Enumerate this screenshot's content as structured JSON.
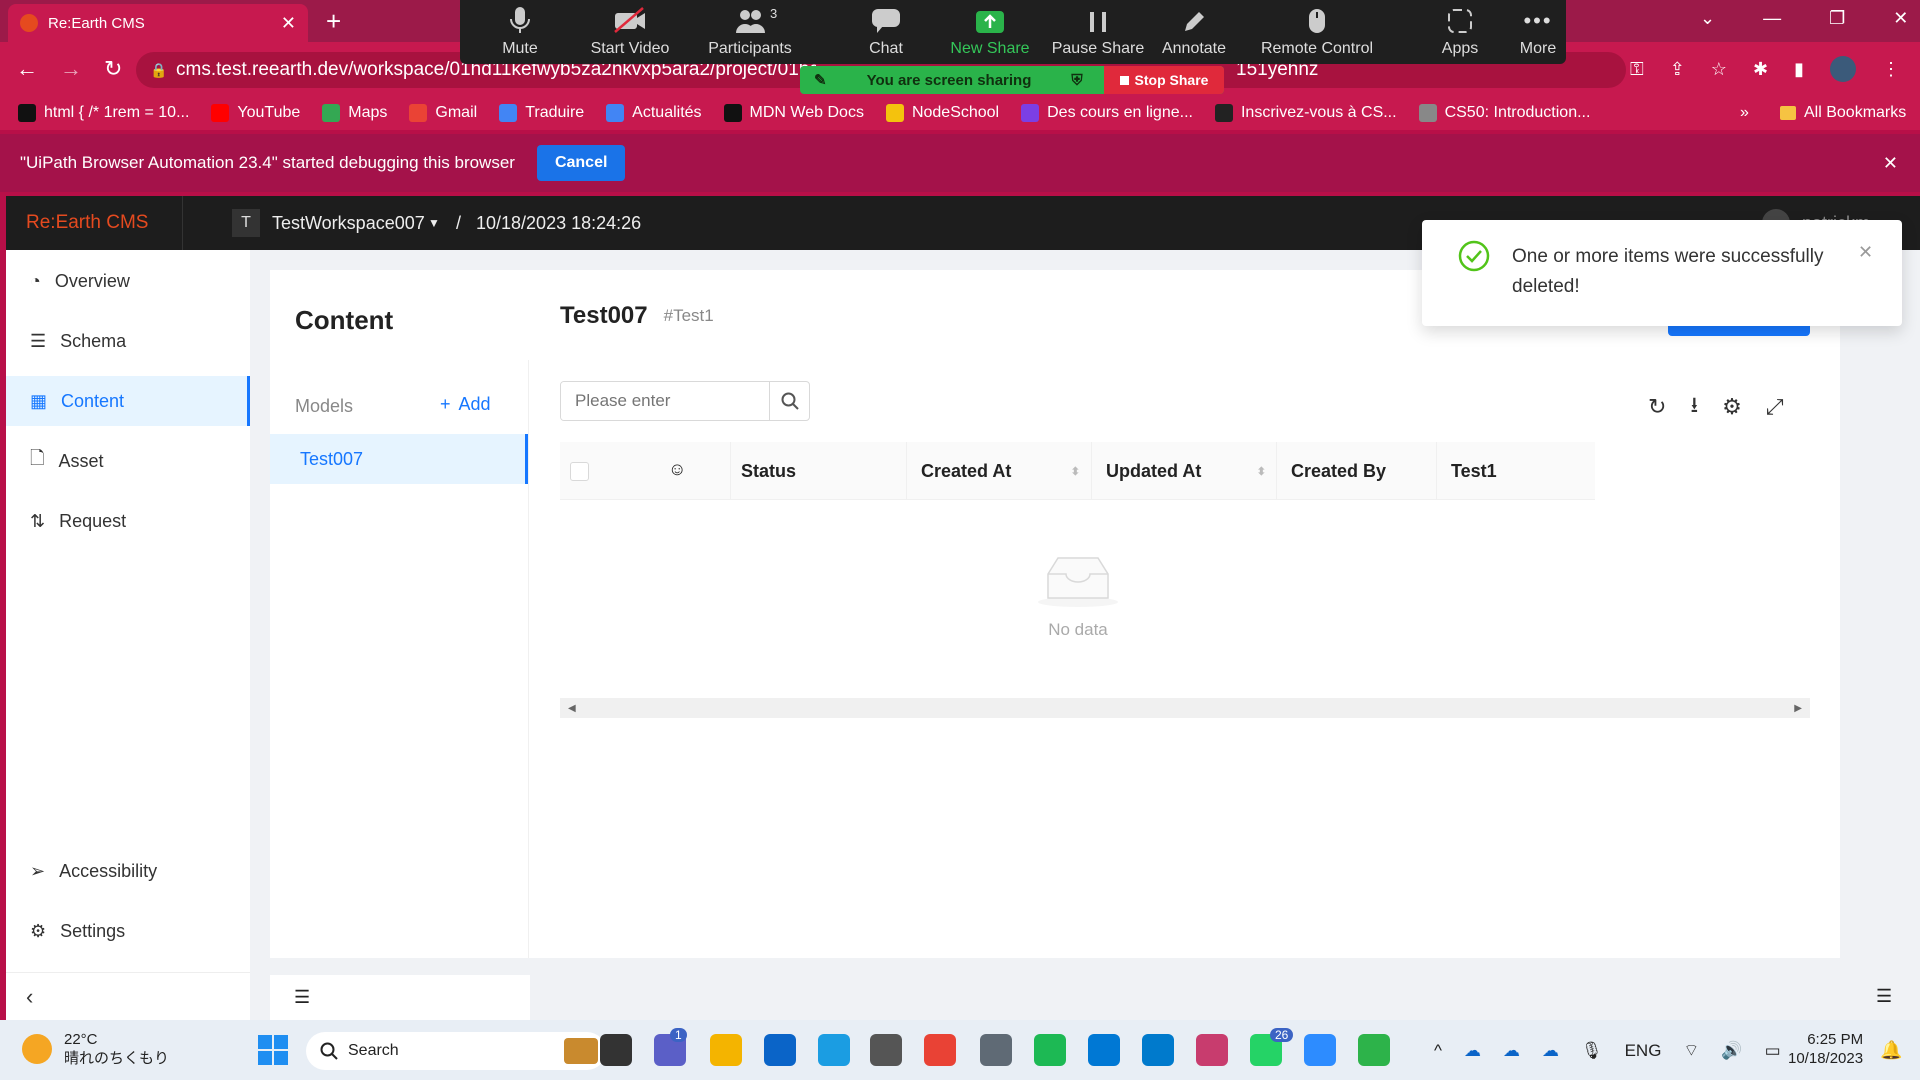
{
  "browser": {
    "tab_title": "Re:Earth CMS",
    "url": "cms.test.reearth.dev/workspace/01hd11kefwyb5za2nkvxp5ara2/project/01hd11k",
    "url_tail": "151yehnz",
    "bookmarks": [
      "html { /* 1rem = 10...",
      "YouTube",
      "Maps",
      "Gmail",
      "Traduire",
      "Actualités",
      "MDN Web Docs",
      "NodeSchool",
      "Des cours en ligne...",
      "Inscrivez-vous à CS...",
      "CS50: Introduction..."
    ],
    "bookmark_colors": [
      "#111111",
      "#ff0000",
      "#34a853",
      "#ea4335",
      "#4285f4",
      "#4285f4",
      "#111111",
      "#f4c20d",
      "#7b3fe4",
      "#222222",
      "#888888"
    ],
    "more_bookmarks": "»",
    "all_bookmarks": "All Bookmarks",
    "debug_message": "\"UiPath Browser Automation 23.4\" started debugging this browser",
    "debug_cancel": "Cancel"
  },
  "zoom": {
    "mute": "Mute",
    "start_video": "Start Video",
    "participants": "Participants",
    "participants_count": "3",
    "chat": "Chat",
    "new_share": "New Share",
    "pause_share": "Pause Share",
    "annotate": "Annotate",
    "remote_control": "Remote Control",
    "apps": "Apps",
    "more": "More",
    "sharing_text": "You are screen sharing",
    "stop_share": "Stop Share"
  },
  "app": {
    "logo": "Re:Earth CMS",
    "workspace_initial": "T",
    "workspace_name": "TestWorkspace007",
    "separator": "/",
    "project": "10/18/2023 18:24:26",
    "user": "patrickm",
    "nav": [
      "Overview",
      "Schema",
      "Content",
      "Asset",
      "Request"
    ],
    "nav_bottom": [
      "Accessibility",
      "Settings"
    ],
    "content_title": "Content",
    "models_label": "Models",
    "add_label": "Add",
    "models": [
      "Test007"
    ],
    "model_title": "Test007",
    "model_key": "#Test1",
    "search_placeholder": "Please enter",
    "columns": [
      "Status",
      "Created At",
      "Updated At",
      "Created By",
      "Test1"
    ],
    "empty": "No data",
    "notification": "One or more items were successfully deleted!"
  },
  "taskbar": {
    "weather_temp": "22°C",
    "weather_text": "晴れのちくもり",
    "search": "Search",
    "teams_badge": "1",
    "whatsapp_badge": "26",
    "lang": "ENG",
    "time": "6:25 PM",
    "date": "10/18/2023"
  },
  "colors": {
    "accent": "#1677ff",
    "brand": "#e54a1f",
    "success": "#52c41a",
    "chrome": "#c7194f"
  }
}
